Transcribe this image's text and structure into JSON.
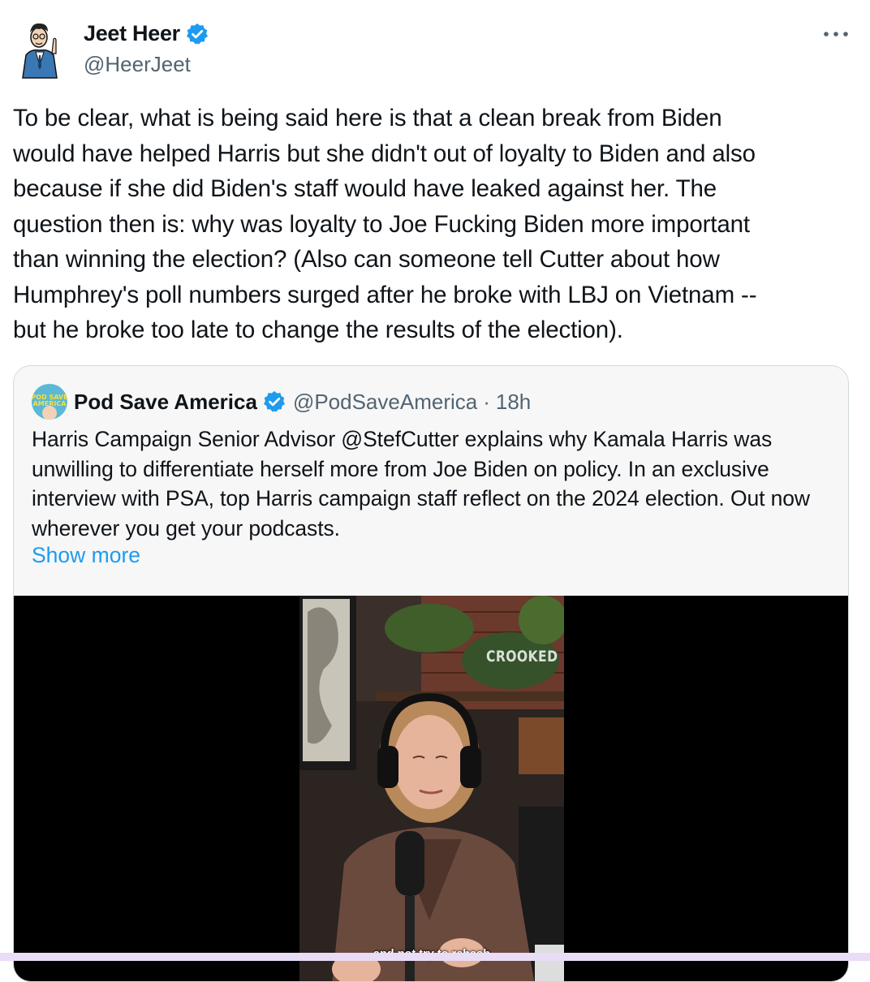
{
  "tweet": {
    "author": {
      "name": "Jeet Heer",
      "handle": "@HeerJeet",
      "avatar_icon": "cartoon-man-avatar",
      "verified": true
    },
    "more_icon": "more-horizontal-icon",
    "text": "To be clear, what is being said here is that a clean break from Biden\nwould have helped Harris but she didn't out of loyalty to Biden and also\nbecause if she did Biden's staff would have leaked against her. The\nquestion then is: why was loyalty to Joe Fucking Biden more important\nthan winning the election? (Also can someone tell Cutter about how\nHumphrey's poll numbers surged after he broke with LBJ on Vietnam --\nbut he broke too late to change the results of the election)."
  },
  "quote": {
    "author": {
      "name": "Pod Save America",
      "handle": "@PodSaveAmerica",
      "avatar_text": "POD SAVE AMERICA",
      "verified": true
    },
    "separator": "·",
    "time": "18h",
    "text": "Harris Campaign Senior Advisor @StefCutter explains why Kamala Harris was unwilling to differentiate herself more from Joe Biden on policy. In an exclusive interview with PSA, top Harris campaign staff reflect on the 2024 election. Out now wherever you get your podcasts.",
    "show_more": "Show more",
    "video": {
      "watermark": "CROOKED",
      "caption": "and not try to rehash"
    }
  },
  "colors": {
    "text": "#0f1419",
    "secondary": "#536471",
    "link": "#1d9bf0",
    "verified": "#1d9bf0",
    "border": "#cfd9de"
  }
}
